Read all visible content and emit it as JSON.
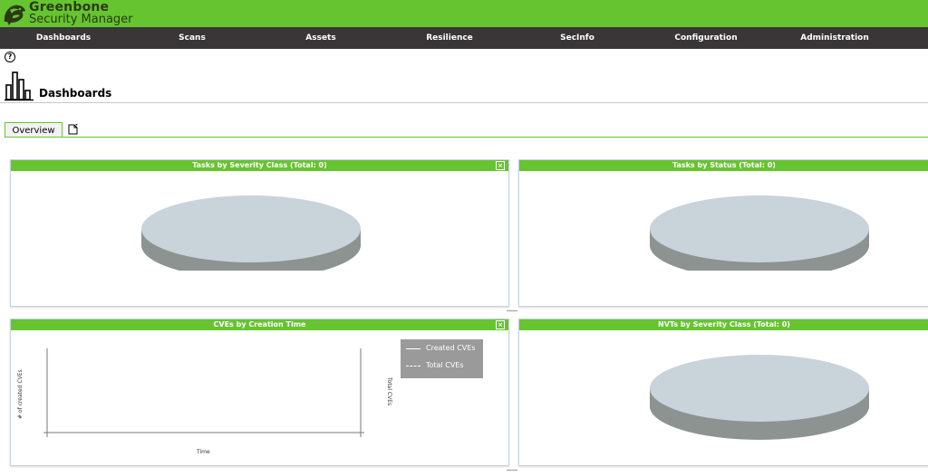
{
  "app": {
    "name_line1": "Greenbone",
    "name_line2": "Security Manager"
  },
  "nav": {
    "items": [
      {
        "label": "Dashboards"
      },
      {
        "label": "Scans"
      },
      {
        "label": "Assets"
      },
      {
        "label": "Resilience"
      },
      {
        "label": "SecInfo"
      },
      {
        "label": "Configuration"
      },
      {
        "label": "Administration"
      }
    ]
  },
  "page": {
    "help_icon": "?",
    "title": "Dashboards",
    "title_icon": "bar-chart-icon"
  },
  "tabs": {
    "overview_label": "Overview",
    "new_tab_icon": "new-dashboard-icon"
  },
  "panels": {
    "tasks_severity": {
      "title": "Tasks by Severity Class (Total: 0)",
      "close": "×"
    },
    "tasks_status": {
      "title": "Tasks by Status (Total: 0)"
    },
    "cves_time": {
      "title": "CVEs by Creation Time",
      "close": "×",
      "ylabel_left": "# of created CVEs",
      "ylabel_right": "Total CVEs",
      "xlabel": "Time",
      "legend": [
        "Created CVEs",
        "Total CVEs"
      ]
    },
    "nvts_severity": {
      "title": "NVTs by Severity Class (Total: 0)"
    }
  },
  "colors": {
    "brand_green": "#66c430",
    "nav_bg": "#393637",
    "pie_top": "#c9d3da",
    "pie_side": "#8c9391",
    "legend_bg": "#9a9a9a"
  }
}
